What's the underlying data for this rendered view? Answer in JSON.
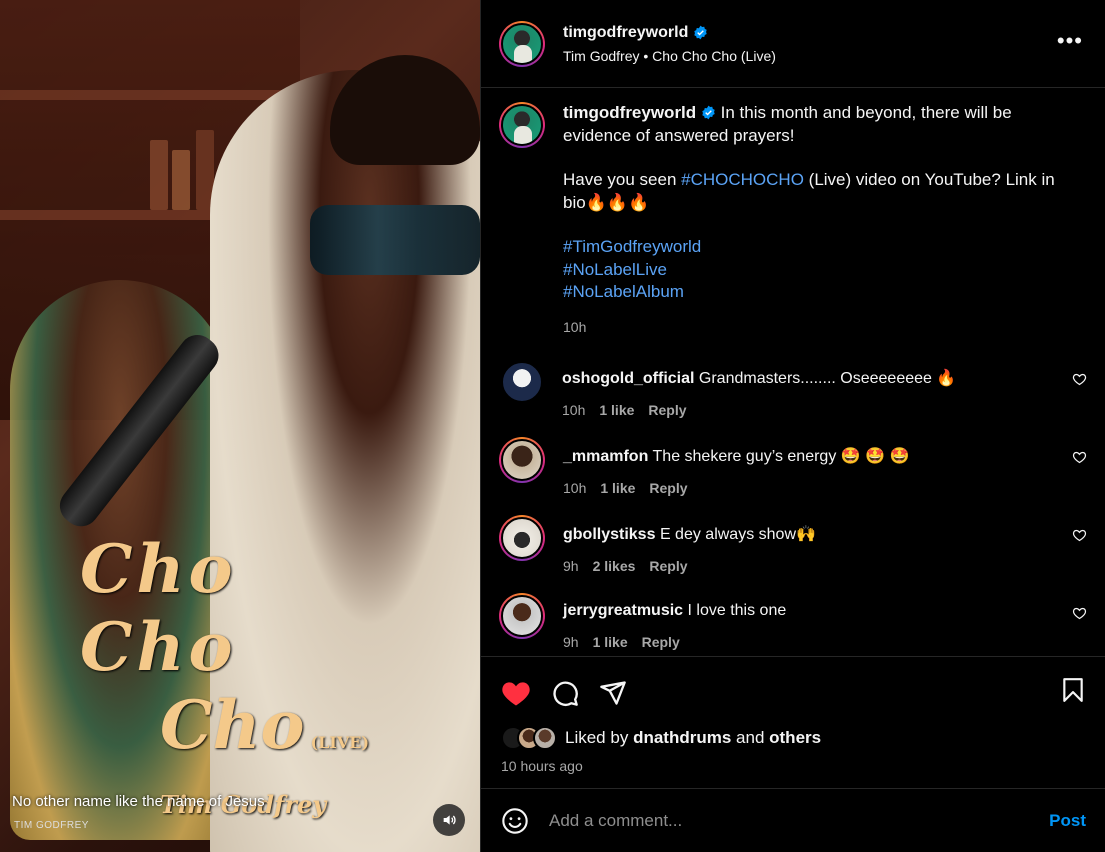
{
  "media": {
    "overlay_line1": "Cho Cho",
    "overlay_line2": "Cho",
    "overlay_live": "(LIVE)",
    "overlay_artist": "Tim Godfrey",
    "caption": "No other name like the name of Jesus",
    "caption_sub": "TIM GODFREY",
    "sound_icon": "speaker-icon"
  },
  "header": {
    "username": "timgodfreyworld",
    "subtitle": "Tim Godfrey • Cho Cho Cho (Live)",
    "more_icon": "•••"
  },
  "post_caption": {
    "username": "timgodfreyworld",
    "line1": "In this month and beyond, there will be evidence of answered prayers!",
    "line2_pre": "Have you seen ",
    "line2_tag": "#CHOCHOCHO",
    "line2_post": " (Live) video on YouTube? Link in bio🔥🔥🔥",
    "tags": [
      "#TimGodfreyworld",
      "#NoLabelLive",
      "#NoLabelAlbum"
    ],
    "time": "10h"
  },
  "comments": [
    {
      "username": "oshogold_official",
      "text": "Grandmasters........ Oseeeeeeee 🔥",
      "time": "10h",
      "likes": "1 like",
      "reply": "Reply"
    },
    {
      "username": "_mmamfon",
      "text": "The shekere guy’s energy 🤩 🤩 🤩",
      "time": "10h",
      "likes": "1 like",
      "reply": "Reply"
    },
    {
      "username": "gbollystikss",
      "text": "E dey always show🙌",
      "time": "9h",
      "likes": "2 likes",
      "reply": "Reply"
    },
    {
      "username": "jerrygreatmusic",
      "text": "I love this one",
      "time": "9h",
      "likes": "1 like",
      "reply": "Reply"
    }
  ],
  "likes": {
    "prefix": "Liked by",
    "user": "dnathdrums",
    "and": "and",
    "others": "others",
    "ago": "10 hours ago"
  },
  "add_comment": {
    "placeholder": "Add a comment...",
    "post_label": "Post"
  },
  "colors": {
    "accent_blue": "#0095f6",
    "hashtag": "#5ba3f5",
    "like_red": "#ff3040",
    "verified": "#0095f6"
  }
}
